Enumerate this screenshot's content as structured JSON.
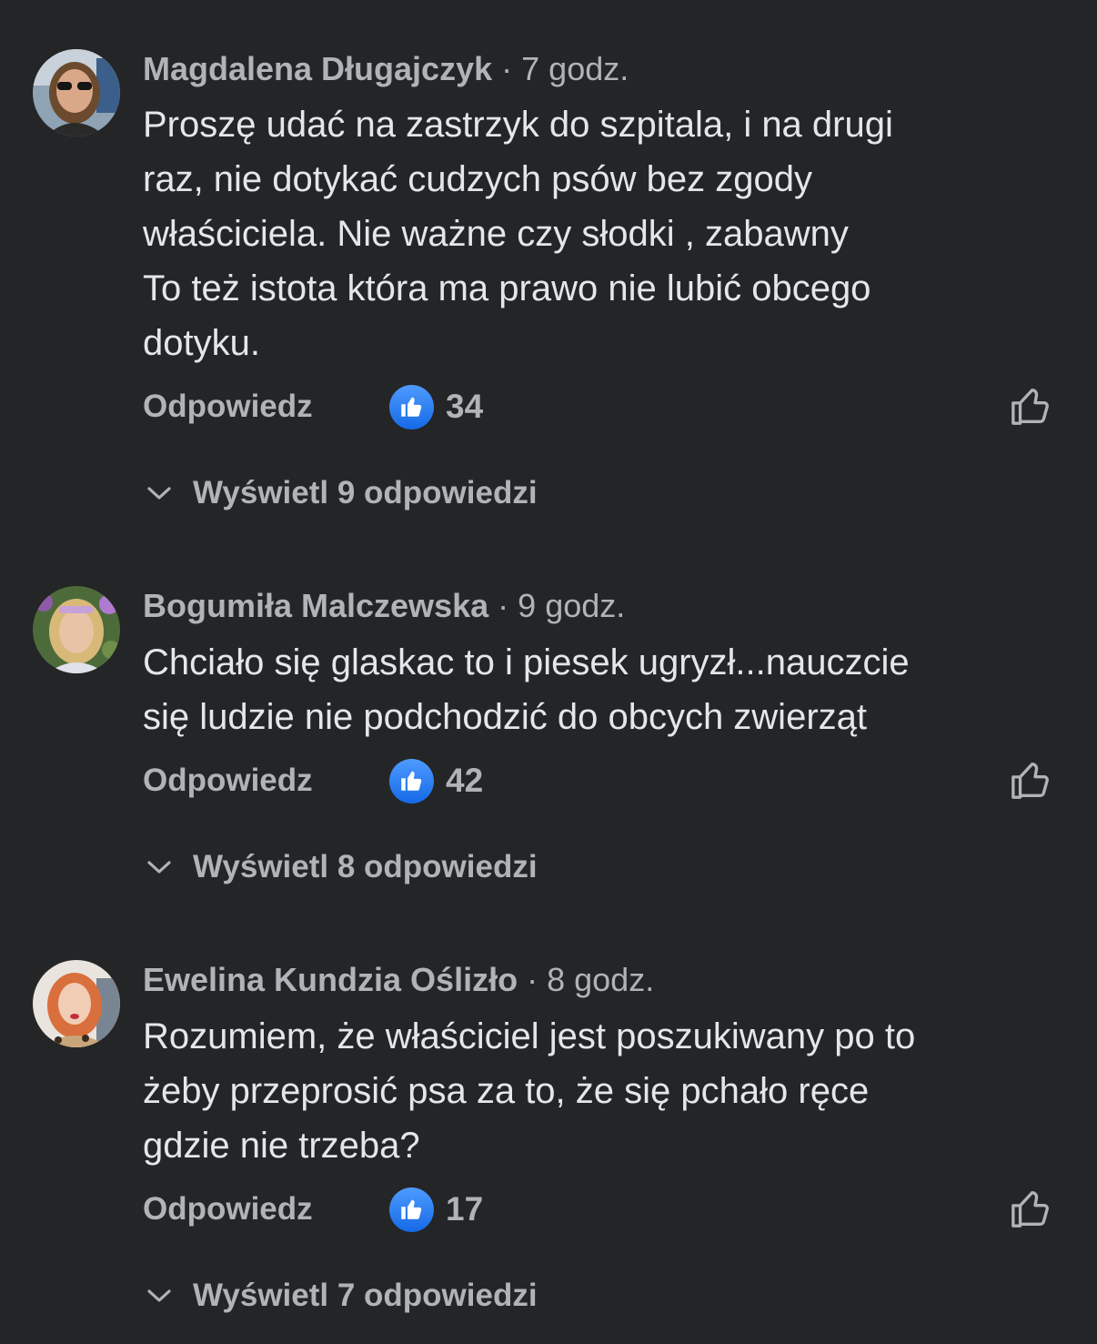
{
  "comments": [
    {
      "author": "Magdalena Długajczyk",
      "separator": "·",
      "time": "7 godz.",
      "text": "Proszę udać na zastrzyk do szpitala, i na drugi\nraz, nie dotykać cudzych psów bez zgody\nwłaściciela.  Nie ważne czy słodki , zabawny\nTo też istota która ma prawo nie lubić obcego\ndotyku.",
      "reply_label": "Odpowiedz",
      "reaction_count": "34",
      "view_replies_label": "Wyświetl 9 odpowiedzi"
    },
    {
      "author": "Bogumiła Malczewska",
      "separator": "·",
      "time": "9 godz.",
      "text": "Chciało się glaskac to i piesek ugryzł...nauczcie\nsię ludzie nie podchodzić do obcych zwierząt",
      "reply_label": "Odpowiedz",
      "reaction_count": "42",
      "view_replies_label": "Wyświetl 8 odpowiedzi"
    },
    {
      "author": "Ewelina Kundzia Oślizło",
      "separator": "·",
      "time": "8 godz.",
      "text": "Rozumiem, że właściciel jest poszukiwany po to\nżeby przeprosić psa za to, że się pchało ręce\ngdzie nie trzeba?",
      "reply_label": "Odpowiedz",
      "reaction_count": "17",
      "view_replies_label": "Wyświetl 7 odpowiedzi"
    }
  ],
  "colors": {
    "background": "#242526",
    "primary_text": "#e4e6eb",
    "secondary_text": "#b0b3b8",
    "reaction_blue": "#1877f2"
  },
  "icons": {
    "reaction_badge": "thumbs-up-reaction-icon",
    "like_button": "thumbs-up-outline-icon",
    "expand": "chevron-down-icon"
  }
}
